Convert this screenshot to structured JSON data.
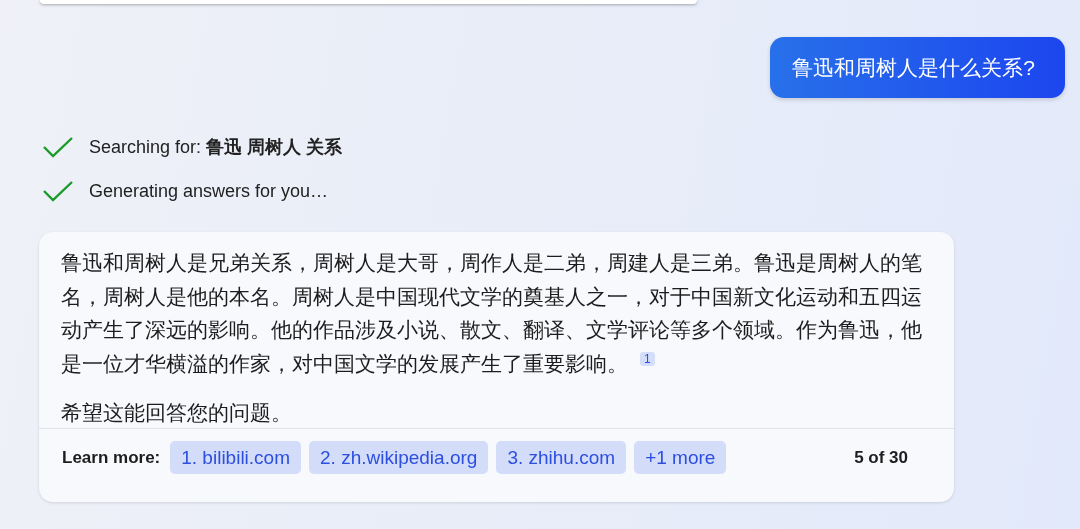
{
  "user_message": "鲁迅和周树人是什么关系?",
  "steps": [
    {
      "label": "Searching for: ",
      "query": "鲁迅 周树人 关系",
      "done": true
    },
    {
      "label": "Generating answers for you…",
      "done": true
    }
  ],
  "answer": {
    "paragraphs": [
      {
        "text": "鲁迅和周树人是兄弟关系，周树人是大哥，周作人是二弟，周建人是三弟。鲁迅是周树人的笔名，周树人是他的本名。周树人是中国现代文学的奠基人之一，对于中国新文化运动和五四运动产生了深远的影响。他的作品涉及小说、散文、翻译、文学评论等多个领域。作为鲁迅，他是一位才华横溢的作家，对中国文学的发展产生了重要影响。",
        "citation": "1"
      },
      {
        "text": "希望这能回答您的问题。"
      }
    ],
    "learn_more_label": "Learn more:",
    "sources": [
      "1. bilibili.com",
      "2. zh.wikipedia.org",
      "3. zhihu.com",
      "+1 more"
    ],
    "count": "5 of 30"
  }
}
